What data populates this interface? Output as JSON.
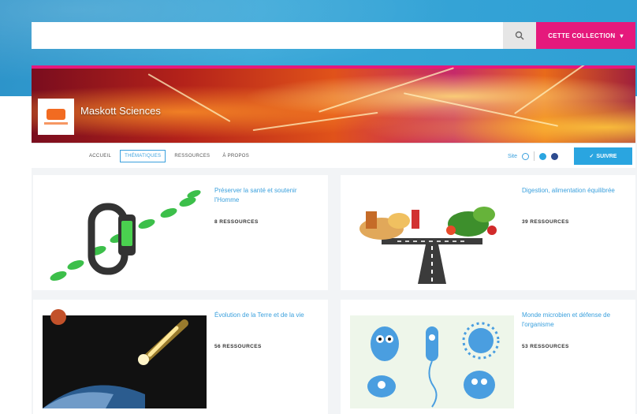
{
  "search": {
    "placeholder": "",
    "scope_label": "CETTE COLLECTION"
  },
  "brand": {
    "name": "Maskott Sciences"
  },
  "tabs": [
    {
      "label": "ACCUEIL",
      "active": false
    },
    {
      "label": "THÉMATIQUES",
      "active": true
    },
    {
      "label": "RESSOURCES",
      "active": false
    },
    {
      "label": "À PROPOS",
      "active": false
    }
  ],
  "header_actions": {
    "site_label": "Site",
    "follow_label": "SUIVRE"
  },
  "cards": [
    {
      "title": "Préserver la santé et soutenir l'Homme",
      "count": "8 RESSOURCES",
      "icon": "fitness-tracker-footsteps"
    },
    {
      "title": "Digestion, alimentation équilibrée",
      "count": "39 RESSOURCES",
      "icon": "food-crossroads"
    },
    {
      "title": "Évolution de la Terre et de la vie",
      "count": "56 RESSOURCES",
      "icon": "meteor-earth"
    },
    {
      "title": "Monde microbien et défense de l'organisme",
      "count": "53 RESSOURCES",
      "icon": "microbes"
    }
  ],
  "colors": {
    "accent_pink": "#e5197c",
    "accent_blue": "#2aa5e0",
    "band_blue": "#39a7d8"
  }
}
